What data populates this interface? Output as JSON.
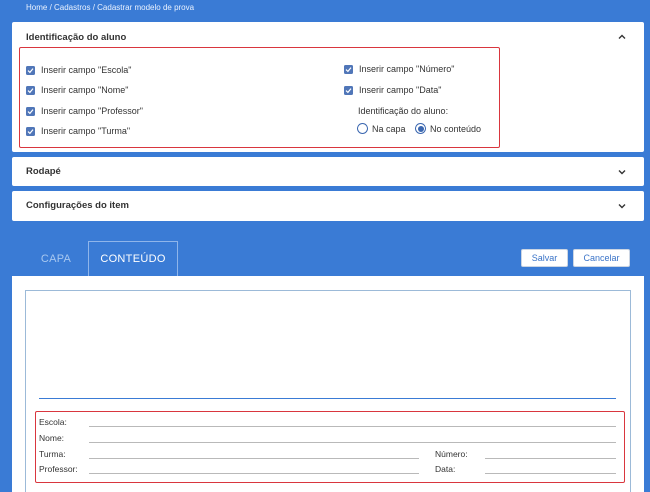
{
  "breadcrumb": "Home / Cadastros / Cadastrar modelo de prova",
  "identificacao": {
    "title": "Identificação do aluno",
    "checkboxes_left": [
      {
        "label": "Inserir campo \"Escola\"",
        "checked": true
      },
      {
        "label": "Inserir campo \"Nome\"",
        "checked": true
      },
      {
        "label": "Inserir campo \"Professor\"",
        "checked": true
      },
      {
        "label": "Inserir campo \"Turma\"",
        "checked": true
      }
    ],
    "checkboxes_right": [
      {
        "label": "Inserir campo \"Número\"",
        "checked": true
      },
      {
        "label": "Inserir campo \"Data\"",
        "checked": true
      }
    ],
    "position_label": "Identificação do aluno:",
    "position_options": [
      {
        "label": "Na capa",
        "selected": false
      },
      {
        "label": "No conteúdo",
        "selected": true
      }
    ]
  },
  "rodape": {
    "title": "Rodapé"
  },
  "configuracoes": {
    "title": "Configurações do item"
  },
  "tabs": [
    {
      "label": "CAPA",
      "active": false
    },
    {
      "label": "CONTEÚDO",
      "active": true
    }
  ],
  "buttons": {
    "save": "Salvar",
    "cancel": "Cancelar"
  },
  "form_fields": {
    "escola": "Escola:",
    "nome": "Nome:",
    "turma": "Turma:",
    "numero": "Número:",
    "professor": "Professor:",
    "data": "Data:"
  },
  "colors": {
    "background": "#3a7bd5",
    "checkbox": "#5076b8",
    "highlight_border": "#d9363e"
  }
}
